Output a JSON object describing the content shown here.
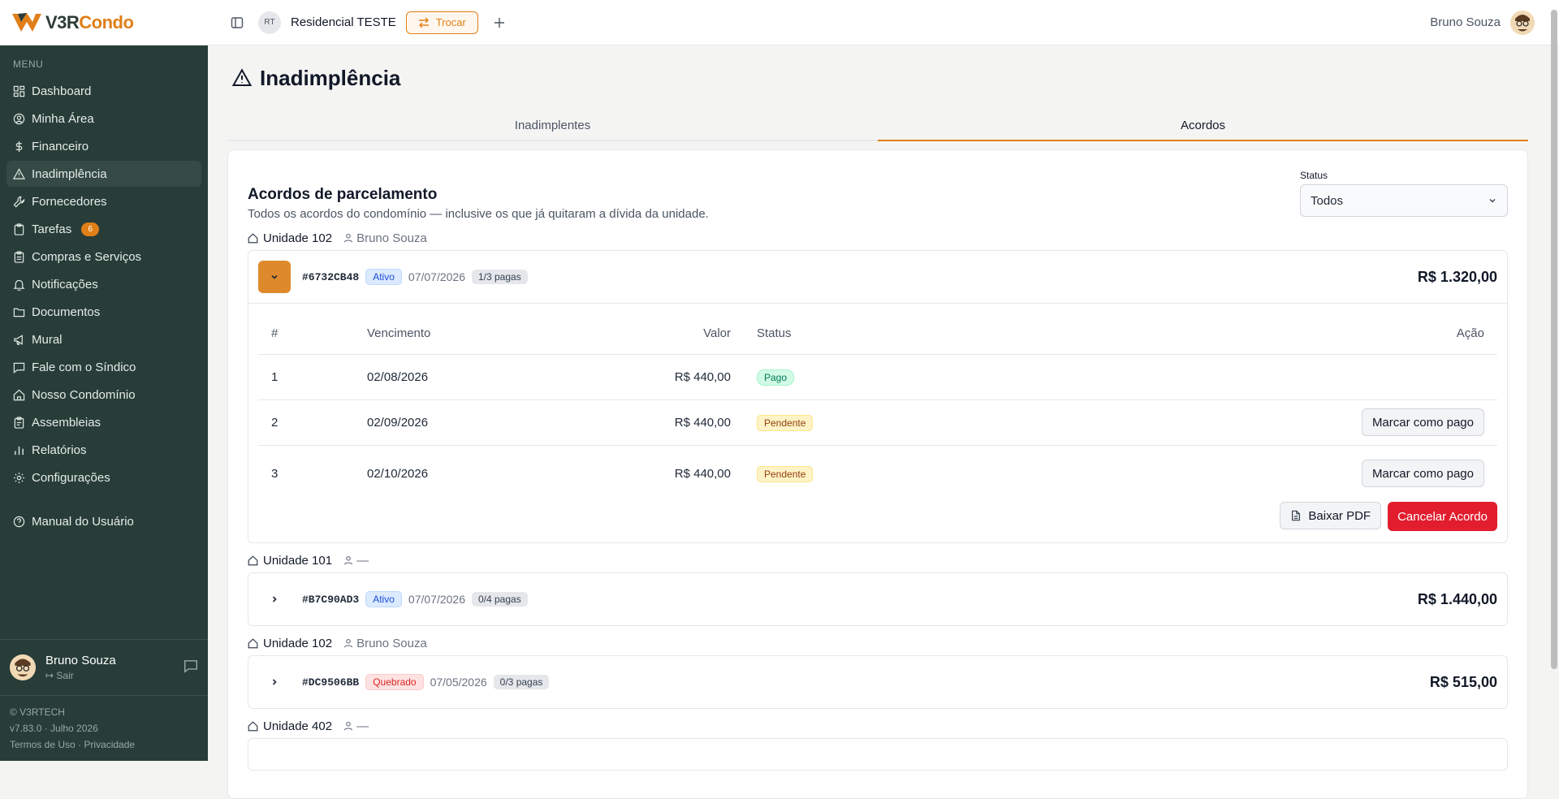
{
  "brand": {
    "prefix": "V3R",
    "suffix": "Condo",
    "accent": "#e07f17",
    "sidebar_bg": "#283d38"
  },
  "topbar": {
    "condo_initials": "RT",
    "condo_name": "Residencial TESTE",
    "switch_label": "Trocar",
    "user_name": "Bruno Souza"
  },
  "sidebar": {
    "menu_title": "MENU",
    "items": [
      {
        "label": "Dashboard",
        "icon": "grid-icon"
      },
      {
        "label": "Minha Área",
        "icon": "user-circle-icon"
      },
      {
        "label": "Financeiro",
        "icon": "dollar-icon"
      },
      {
        "label": "Inadimplência",
        "icon": "alert-triangle-icon"
      },
      {
        "label": "Fornecedores",
        "icon": "wrench-icon"
      },
      {
        "label": "Tarefas",
        "icon": "clipboard-icon",
        "badge": "6"
      },
      {
        "label": "Compras e Serviços",
        "icon": "clipboard-list-icon"
      },
      {
        "label": "Notificações",
        "icon": "bell-icon"
      },
      {
        "label": "Documentos",
        "icon": "folder-icon"
      },
      {
        "label": "Mural",
        "icon": "megaphone-icon"
      },
      {
        "label": "Fale com o Síndico",
        "icon": "message-icon"
      },
      {
        "label": "Nosso Condomínio",
        "icon": "home-icon"
      },
      {
        "label": "Assembleias",
        "icon": "clipboard-icon"
      },
      {
        "label": "Relatórios",
        "icon": "bar-chart-icon"
      },
      {
        "label": "Configurações",
        "icon": "gear-icon"
      },
      {
        "label": "Manual do Usuário",
        "icon": "help-circle-icon"
      }
    ],
    "user_name": "Bruno Souza",
    "logout": "Sair",
    "copyright": "© V3RTECH",
    "version": "v7.83.0 · Julho 2026",
    "terms": "Termos de Uso",
    "privacy": "Privacidade"
  },
  "page": {
    "title": "Inadimplência",
    "tabs": [
      "Inadimplentes",
      "Acordos"
    ]
  },
  "card": {
    "title": "Acordos de parcelamento",
    "description": "Todos os acordos do condomínio — inclusive os que já quitaram a dívida da unidade.",
    "status_label": "Status",
    "status_value": "Todos"
  },
  "acordos": [
    {
      "unit": "Unidade 102",
      "owner": "Bruno Souza",
      "id": "#6732CB48",
      "status": "Ativo",
      "date": "07/07/2026",
      "paid": "1/3 pagas",
      "total": "R$ 1.320,00"
    },
    {
      "unit": "Unidade 101",
      "owner": "—",
      "id": "#B7C90AD3",
      "status": "Ativo",
      "date": "07/07/2026",
      "paid": "0/4 pagas",
      "total": "R$ 1.440,00"
    },
    {
      "unit": "Unidade 102",
      "owner": "Bruno Souza",
      "id": "#DC9506BB",
      "status": "Quebrado",
      "date": "07/05/2026",
      "paid": "0/3 pagas",
      "total": "R$ 515,00"
    },
    {
      "unit": "Unidade 402",
      "owner": "—"
    }
  ],
  "installments": {
    "headers": [
      "#",
      "Vencimento",
      "Valor",
      "Status",
      "Ação"
    ],
    "rows": [
      {
        "n": "1",
        "due": "02/08/2026",
        "value": "R$ 440,00",
        "status": "Pago",
        "action": ""
      },
      {
        "n": "2",
        "due": "02/09/2026",
        "value": "R$ 440,00",
        "status": "Pendente",
        "action": "Marcar como pago"
      },
      {
        "n": "3",
        "due": "02/10/2026",
        "value": "R$ 440,00",
        "status": "Pendente",
        "action": "Marcar como pago"
      }
    ],
    "pdf_label": "Baixar PDF",
    "cancel_label": "Cancelar Acordo"
  }
}
